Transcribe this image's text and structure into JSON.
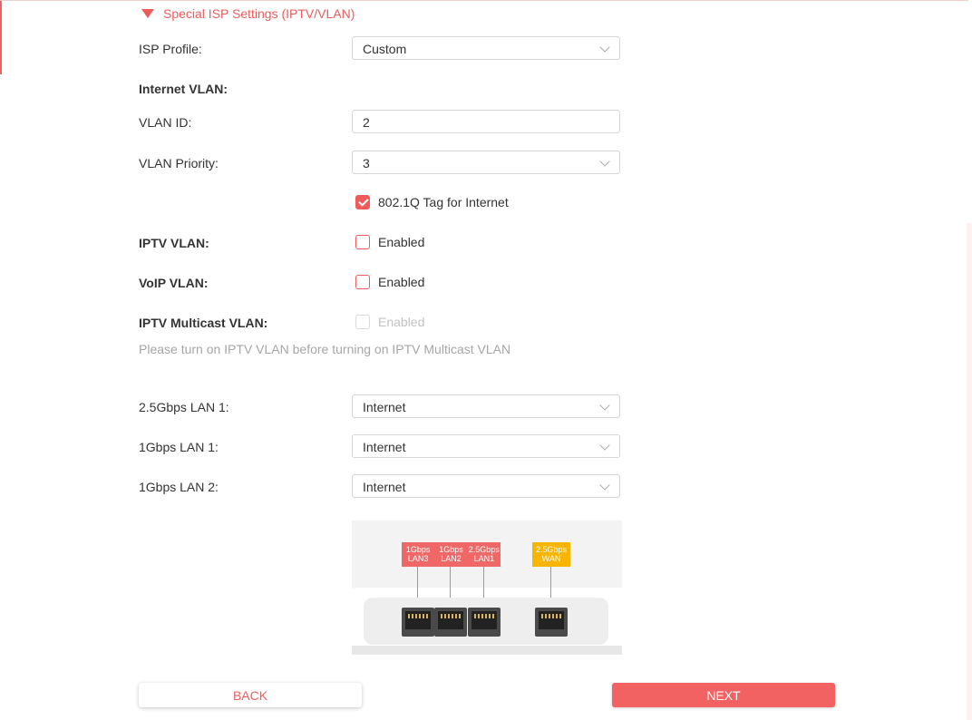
{
  "section": {
    "title": "Special ISP Settings (IPTV/VLAN)",
    "icon": "triangle-down-icon",
    "accent_color": "#ef5b5b"
  },
  "isp_profile": {
    "label": "ISP Profile:",
    "value": "Custom"
  },
  "internet_vlan": {
    "heading": "Internet VLAN:",
    "vlan_id_label": "VLAN ID:",
    "vlan_id_value": "2",
    "priority_label": "VLAN Priority:",
    "priority_value": "3",
    "tag_label": "802.1Q Tag for Internet",
    "tag_checked": true
  },
  "iptv_vlan": {
    "label": "IPTV VLAN:",
    "check_label": "Enabled",
    "checked": false
  },
  "voip_vlan": {
    "label": "VoIP VLAN:",
    "check_label": "Enabled",
    "checked": false
  },
  "iptv_multicast": {
    "label": "IPTV Multicast VLAN:",
    "check_label": "Enabled",
    "checked": false,
    "disabled": true
  },
  "hint": "Please turn on IPTV VLAN before turning on IPTV Multicast VLAN",
  "ports": [
    {
      "label": "2.5Gbps LAN 1:",
      "value": "Internet"
    },
    {
      "label": "1Gbps LAN 1:",
      "value": "Internet"
    },
    {
      "label": "1Gbps LAN 2:",
      "value": "Internet"
    }
  ],
  "diagram": {
    "lan_tags": [
      {
        "line1": "1Gbps",
        "line2": "LAN3"
      },
      {
        "line1": "1Gbps",
        "line2": "LAN2"
      },
      {
        "line1": "2.5Gbps",
        "line2": "LAN1"
      }
    ],
    "wan_tag": {
      "line1": "2.5Gbps",
      "line2": "WAN"
    },
    "lan_color": "#f06767",
    "wan_color": "#f7b500"
  },
  "buttons": {
    "back": "BACK",
    "next": "NEXT"
  }
}
